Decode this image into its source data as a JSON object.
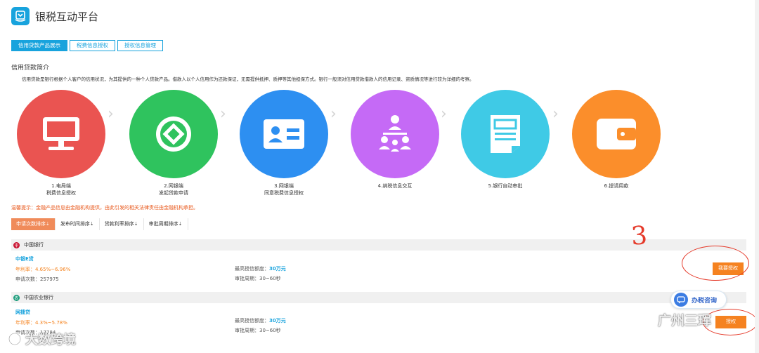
{
  "app": {
    "title": "银税互动平台"
  },
  "tabs": [
    {
      "label": "信用贷款产品展示",
      "active": true
    },
    {
      "label": "税费信息授权",
      "active": false
    },
    {
      "label": "授权信息管理",
      "active": false
    }
  ],
  "section": {
    "title": "信用贷款简介",
    "intro": "信用贷款是银行根据个人客户的信用状况，为其提供的一种个人贷款产品。借款人以个人信用作为还款保证，无需提供抵押、质押等其他担保方式。银行一般须对信用贷款借款人的信用记录、资质情况等进行较为详细的考察。"
  },
  "steps": [
    {
      "line1": "1.电局端",
      "line2": "税费信息授权",
      "color": "#ea5451",
      "icon": "monitor-icon"
    },
    {
      "line1": "2.网银端",
      "line2": "发起贷款申请",
      "color": "#2fc35e",
      "icon": "coin-icon"
    },
    {
      "line1": "3.网银端",
      "line2": "同意税费信息授权",
      "color": "#2d8ff1",
      "icon": "id-card-icon"
    },
    {
      "line1": "4.纳税信息交互",
      "line2": "",
      "color": "#c56af6",
      "icon": "org-chart-icon"
    },
    {
      "line1": "5.银行自动审批",
      "line2": "",
      "color": "#3fcae6",
      "icon": "document-icon"
    },
    {
      "line1": "6.提请用款",
      "line2": "",
      "color": "#fb8e2b",
      "icon": "wallet-icon"
    }
  ],
  "notice": "温馨提示：金融产品信息由金融机构提供，由此引发的相关法律责任由金融机构承担。",
  "sort_options": [
    {
      "label": "申请次数排序⇣",
      "active": true
    },
    {
      "label": "发布时间排序⇣",
      "active": false
    },
    {
      "label": "贷款利率排序⇣",
      "active": false
    },
    {
      "label": "审批周期排序⇣",
      "active": false
    }
  ],
  "banks": [
    {
      "name": "中国银行",
      "color": "#c8102e",
      "product": {
        "name": "中银E贷",
        "rate": "年利率：4.65%~6.96%",
        "count": "申请次数：257975",
        "max_label": "最高授信额度：",
        "max_value": "30万元",
        "period": "审批周期：30~60秒",
        "button": "我要授权"
      }
    },
    {
      "name": "中国农业银行",
      "color": "#1a9b7a",
      "product": {
        "name": "网捷贷",
        "rate": "年利率：4.3%~5.78%",
        "count": "申请次数：17784",
        "max_label": "最高授信额度：",
        "max_value": "30万元",
        "period": "审批周期：30~60秒",
        "button": "授权"
      }
    }
  ],
  "annotation": {
    "mark": "3",
    "color": "#e53a2a"
  },
  "chat": {
    "label": "办税咨询"
  },
  "watermarks": {
    "left": "大数跨境",
    "right": "广州三珲"
  }
}
